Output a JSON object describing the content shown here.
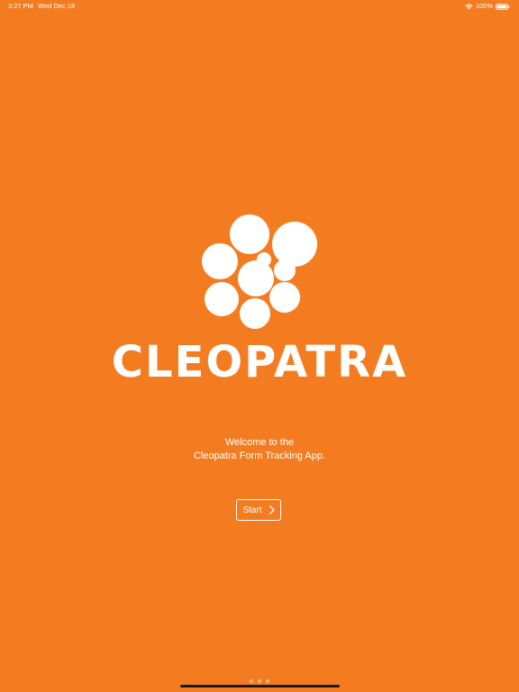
{
  "status_bar": {
    "time": "3:27 PM",
    "date": "Wed Dec 18",
    "battery": "100%",
    "icons": [
      "wifi-icon",
      "battery-icon"
    ]
  },
  "brand": {
    "name": "CLEOPATRA",
    "logo_icon": "cleopatra-bubbles-logo"
  },
  "welcome": {
    "line1": "Welcome to the",
    "line2": "Cleopatra Form Tracking App."
  },
  "start_button": {
    "label": "Start",
    "icon": "chevron-right-icon"
  },
  "pagination": {
    "count": 3
  },
  "colors": {
    "background": "#F47C20",
    "foreground": "#FFFFFF"
  }
}
